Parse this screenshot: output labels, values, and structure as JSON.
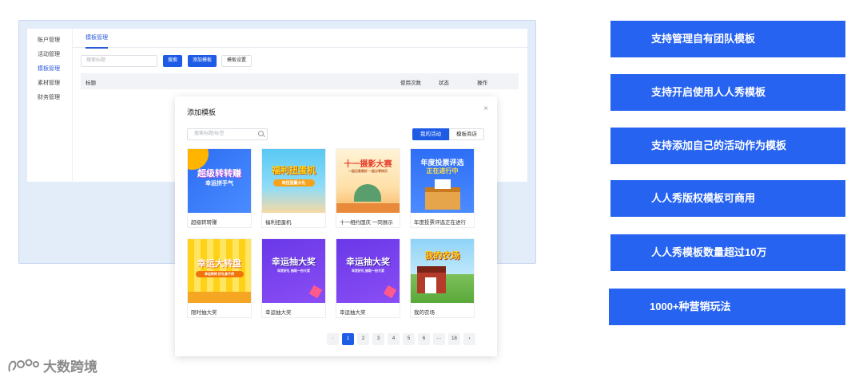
{
  "sidebar": {
    "items": [
      {
        "label": "账户管理",
        "active": false
      },
      {
        "label": "活动管理",
        "active": false
      },
      {
        "label": "模板管理",
        "active": true
      },
      {
        "label": "素材管理",
        "active": false
      },
      {
        "label": "财务管理",
        "active": false
      }
    ]
  },
  "main": {
    "tab": "模板管理",
    "search_placeholder": "搜索标题",
    "search_button": "搜索",
    "add_button": "添加模板",
    "settings_button": "模板设置",
    "columns": [
      "标题",
      "使用次数",
      "状态",
      "操作"
    ]
  },
  "modal": {
    "title": "添加模板",
    "close": "×",
    "search_placeholder": "搜索标题/标签",
    "tabs": [
      "我的活动",
      "模板商店"
    ],
    "templates": [
      {
        "label": "超级转转赚",
        "thumb_title": "超级转转赚",
        "thumb_sub": "幸运拼手气"
      },
      {
        "label": "福利扭蛋机",
        "thumb_title": "福利扭蛋机",
        "thumb_sub": "来扭蛋赢大礼"
      },
      {
        "label": "十一相约国庆 一同展示",
        "thumb_title": "十一摄影大赛",
        "thumb_sub": "一起记录美好 一起分享快乐"
      },
      {
        "label": "年度投票评选正在进行",
        "thumb_title": "年度投票评选",
        "thumb_sub": "正在进行中"
      },
      {
        "label": "限时抽大奖",
        "thumb_title": "幸运大转盘",
        "thumb_sub": "幸运转转 好礼拿不停"
      },
      {
        "label": "幸运抽大奖",
        "thumb_title": "幸运抽大奖",
        "thumb_sub": "年货好礼 抽取一份大奖"
      },
      {
        "label": "幸运抽大奖",
        "thumb_title": "幸运抽大奖",
        "thumb_sub": "年货好礼 抽取一份大奖"
      },
      {
        "label": "我的农场",
        "thumb_title": "我的农场",
        "thumb_sub": ""
      }
    ],
    "pagination": {
      "prev": "‹",
      "pages": [
        "1",
        "2",
        "3",
        "4",
        "5",
        "6",
        "···",
        "18"
      ],
      "next": "›",
      "current": "1"
    }
  },
  "features": [
    "支持管理自有团队模板",
    "支持开启使用人人秀模板",
    "支持添加自己的活动作为模板",
    "人人秀版权模板可商用",
    "人人秀模板数量超过10万",
    "1000+种营销玩法"
  ],
  "watermark": "大数跨境",
  "colors": {
    "accent": "#1f5ce6",
    "feature_bg": "#2663f0",
    "frame_bg": "#e3ecf9"
  }
}
